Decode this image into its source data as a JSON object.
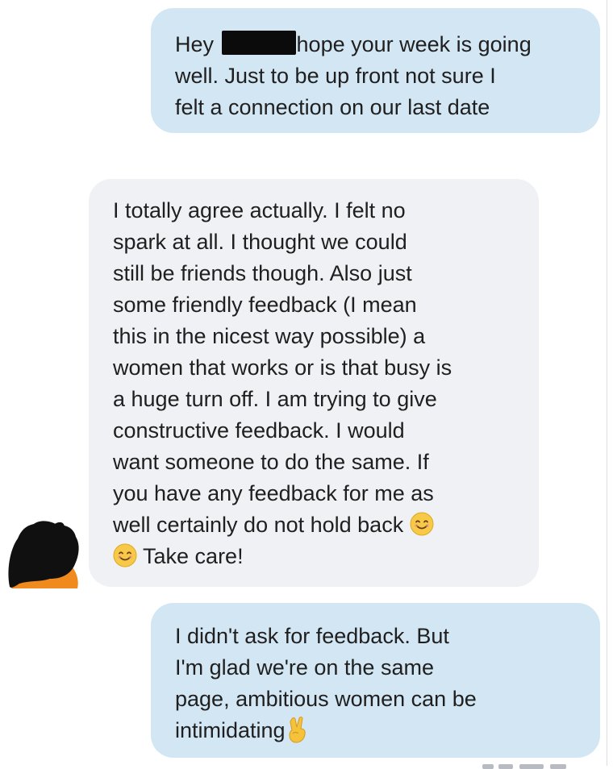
{
  "conversation": {
    "message_1": {
      "sender": "me",
      "line_1_start": "Hey ",
      "line_1_end": "hope your week is going",
      "line_2": "well. Just to be up front not sure I",
      "line_3": "felt a connection on our last date"
    },
    "message_2": {
      "sender": "them",
      "lines": [
        "I totally agree actually.  I felt no",
        "spark at all. I thought we could",
        "still be friends though.  Also just",
        "some friendly feedback (I mean",
        "this in the nicest way possible) a",
        "women that works or is that busy is",
        "a huge turn off.  I am trying to give",
        "constructive feedback.  I would",
        "want someone to do the same.  If",
        "you have any feedback for me as",
        "well certainly do not hold back"
      ],
      "last_line": "Take care!",
      "emoji": "smiling-face"
    },
    "message_3": {
      "sender": "me",
      "lines": [
        "I didn't ask for feedback. But",
        "I'm glad we're on the same",
        "page, ambitious women can be",
        "intimidating"
      ],
      "emoji": "victory-hand"
    }
  },
  "colors": {
    "outgoing_bubble": "#d3e6f3",
    "incoming_bubble": "#eff1f4",
    "text": "#1f1f1f",
    "emoji_face": "#f7c948",
    "redaction": "#0b0b0b"
  }
}
